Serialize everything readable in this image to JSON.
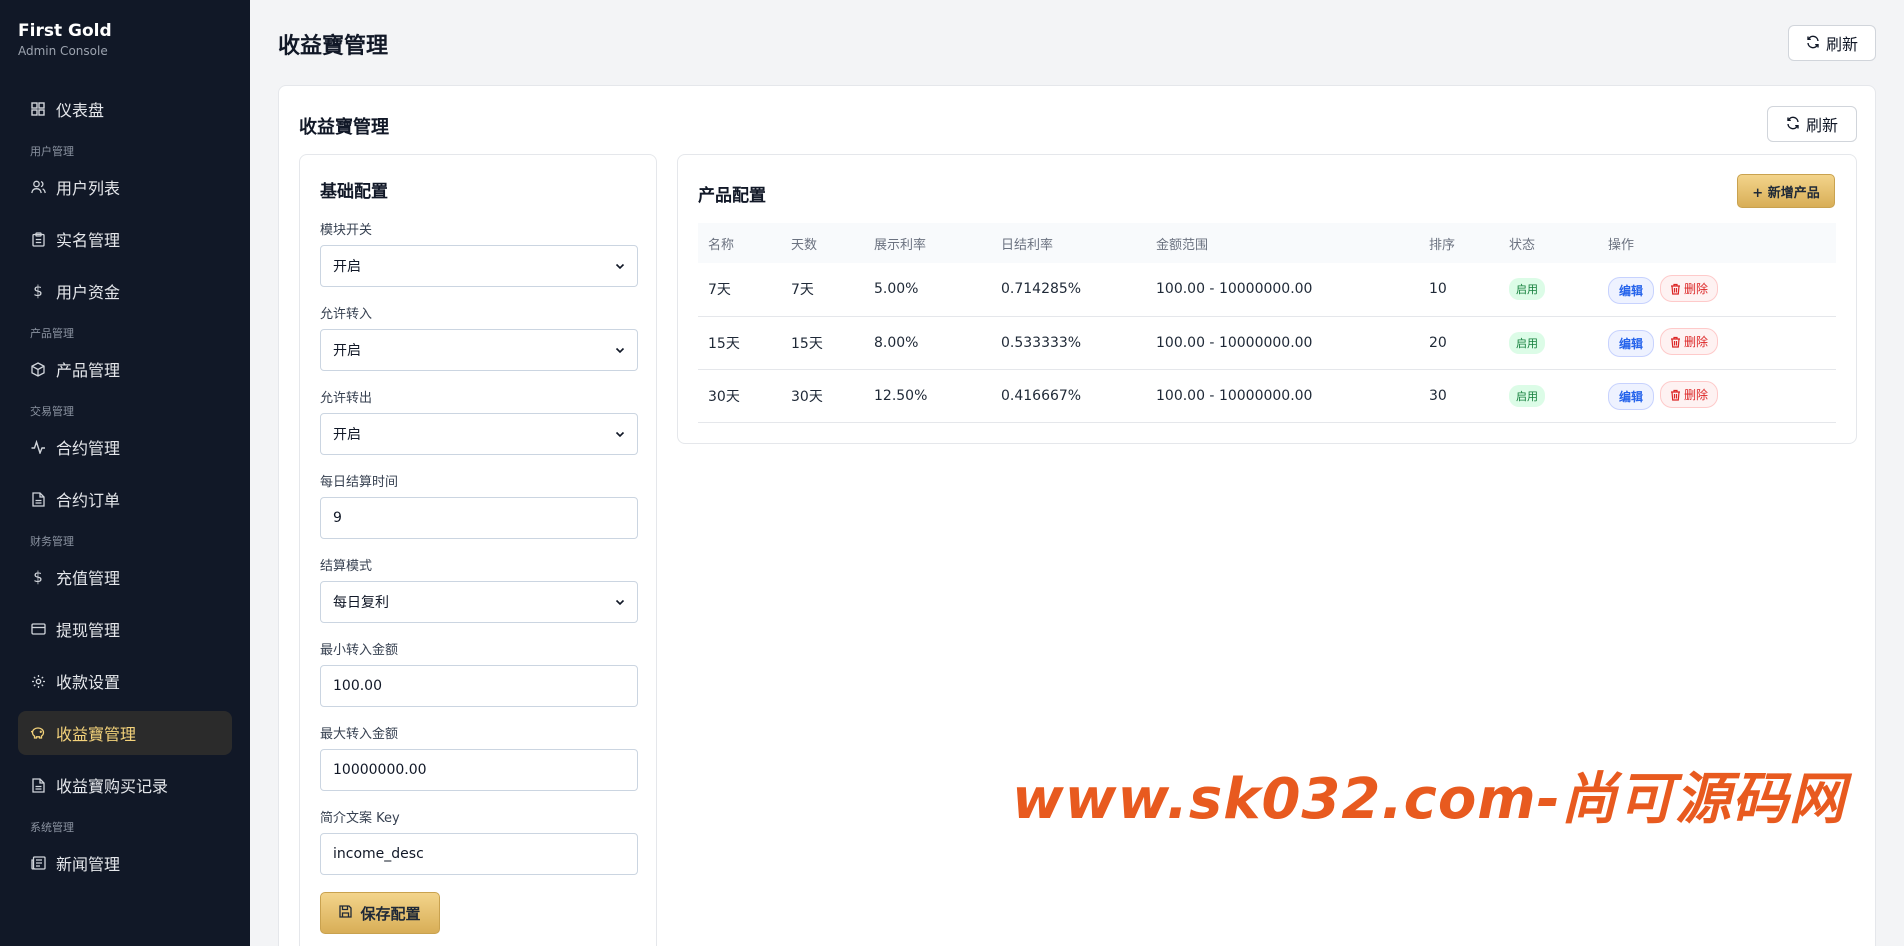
{
  "brand": {
    "title": "First Gold",
    "subtitle": "Admin Console"
  },
  "sidebar": {
    "dashboard": "仪表盘",
    "group_user": "用户管理",
    "user_list": "用户列表",
    "realname": "实名管理",
    "funds": "用户资金",
    "group_product": "产品管理",
    "product_mgmt": "产品管理",
    "group_trade": "交易管理",
    "contract_mgmt": "合约管理",
    "contract_order": "合约订单",
    "group_finance": "财务管理",
    "recharge": "充值管理",
    "withdraw": "提现管理",
    "payment_settings": "收款设置",
    "income_mgmt": "收益寶管理",
    "income_records": "收益寶购买记录",
    "group_system": "系统管理",
    "news": "新闻管理"
  },
  "header": {
    "title": "收益寶管理",
    "refresh": "刷新"
  },
  "panel": {
    "title": "收益寶管理",
    "refresh": "刷新"
  },
  "basic": {
    "title": "基础配置",
    "module_switch": {
      "label": "模块开关",
      "value": "开启"
    },
    "allow_in": {
      "label": "允许转入",
      "value": "开启"
    },
    "allow_out": {
      "label": "允许转出",
      "value": "开启"
    },
    "settle_time": {
      "label": "每日结算时间",
      "value": "9"
    },
    "settle_mode": {
      "label": "结算模式",
      "value": "每日复利"
    },
    "min_in": {
      "label": "最小转入金额",
      "value": "100.00"
    },
    "max_in": {
      "label": "最大转入金额",
      "value": "10000000.00"
    },
    "desc_key": {
      "label": "简介文案 Key",
      "value": "income_desc"
    },
    "save": "保存配置"
  },
  "product": {
    "title": "产品配置",
    "add": "+ 新增产品",
    "columns": [
      "名称",
      "天数",
      "展示利率",
      "日结利率",
      "金额范围",
      "排序",
      "状态",
      "操作"
    ],
    "rows": [
      {
        "name": "7天",
        "days": "7天",
        "show_rate": "5.00%",
        "daily_rate": "0.714285%",
        "range": "100.00 - 10000000.00",
        "sort": "10",
        "status": "启用"
      },
      {
        "name": "15天",
        "days": "15天",
        "show_rate": "8.00%",
        "daily_rate": "0.533333%",
        "range": "100.00 - 10000000.00",
        "sort": "20",
        "status": "启用"
      },
      {
        "name": "30天",
        "days": "30天",
        "show_rate": "12.50%",
        "daily_rate": "0.416667%",
        "range": "100.00 - 10000000.00",
        "sort": "30",
        "status": "启用"
      }
    ],
    "edit": "编辑",
    "delete": "删除"
  },
  "watermark": "www.sk032.com-尚可源码网",
  "colors": {
    "sidebar_bg": "#111827",
    "accent_gold": "#d8ae57",
    "active_text": "#f3d27a",
    "status_green": "#15803d",
    "watermark": "#e85a1f"
  }
}
